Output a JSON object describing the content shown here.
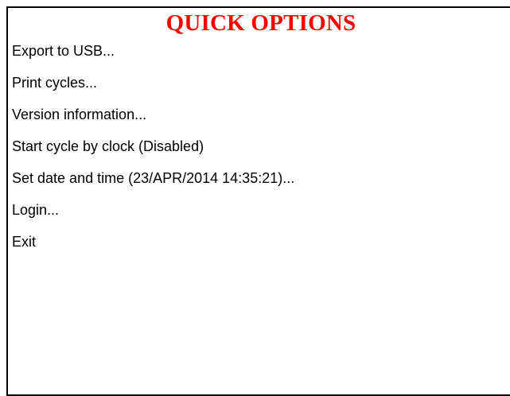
{
  "dialog": {
    "title": "QUICK OPTIONS",
    "title_color": "#ff0000",
    "items": [
      {
        "label": "Export to USB..."
      },
      {
        "label": "Print cycles..."
      },
      {
        "label": "Version information..."
      },
      {
        "label": "Start cycle by clock (Disabled)"
      },
      {
        "label": "Set date and time (23/APR/2014 14:35:21)..."
      },
      {
        "label": "Login..."
      },
      {
        "label": "Exit"
      }
    ]
  }
}
